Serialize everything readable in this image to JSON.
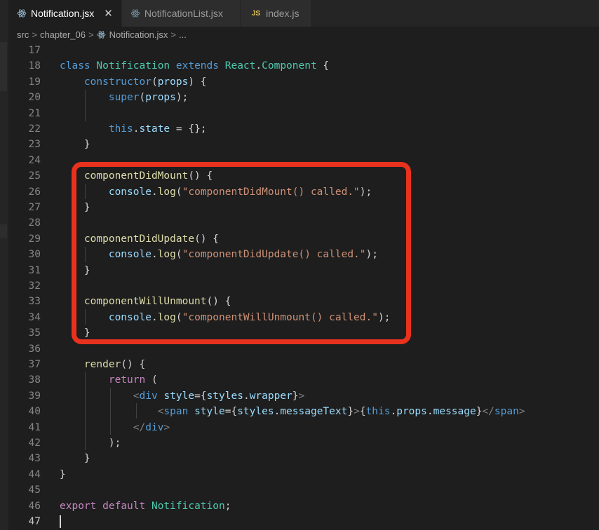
{
  "tabs": [
    {
      "label": "Notification.jsx",
      "icon": "react-icon",
      "active": true,
      "close": "✕"
    },
    {
      "label": "NotificationList.jsx",
      "icon": "react-icon",
      "active": false
    },
    {
      "label": "index.js",
      "icon": "js-icon",
      "icon_text": "JS",
      "active": false
    }
  ],
  "breadcrumb": {
    "items": [
      "src",
      "chapter_06",
      "Notification.jsx",
      "..."
    ],
    "separator": ">"
  },
  "editor": {
    "line_numbers": [
      "17",
      "18",
      "19",
      "20",
      "21",
      "22",
      "23",
      "24",
      "25",
      "26",
      "27",
      "28",
      "29",
      "30",
      "31",
      "32",
      "33",
      "34",
      "35",
      "36",
      "37",
      "38",
      "39",
      "40",
      "41",
      "42",
      "43",
      "44",
      "45",
      "46",
      "47"
    ],
    "current_line": "47",
    "annotation_color": "#e8321e"
  }
}
